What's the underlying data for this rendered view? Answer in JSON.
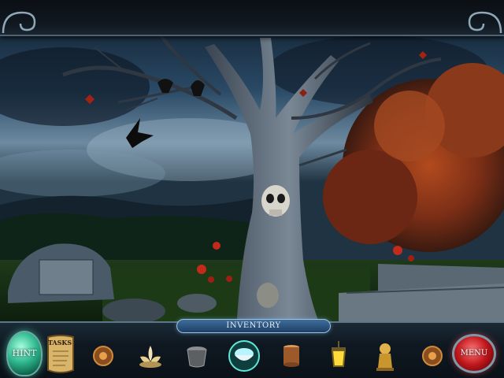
{
  "hud": {
    "hint_label": "HINT",
    "tasks_label": "TASKS",
    "inventory_label": "INVENTORY",
    "menu_label": "MENU"
  },
  "inventory": {
    "items": [
      {
        "icon": "bronze-amulet-icon"
      },
      {
        "icon": "lotus-flower-icon"
      },
      {
        "icon": "metal-bucket-icon"
      },
      {
        "icon": "glowing-bowl-icon"
      },
      {
        "icon": "copper-cylinder-icon"
      },
      {
        "icon": "lantern-icon"
      },
      {
        "icon": "golden-lion-statue-icon"
      },
      {
        "icon": "bronze-amulet-icon"
      }
    ]
  },
  "colors": {
    "sky": "#1c3348",
    "hint_button": "#2fb88e",
    "menu_button": "#c0161b",
    "inventory_tab": "#2a527d",
    "autumn_foliage": "#8a3a1a"
  }
}
